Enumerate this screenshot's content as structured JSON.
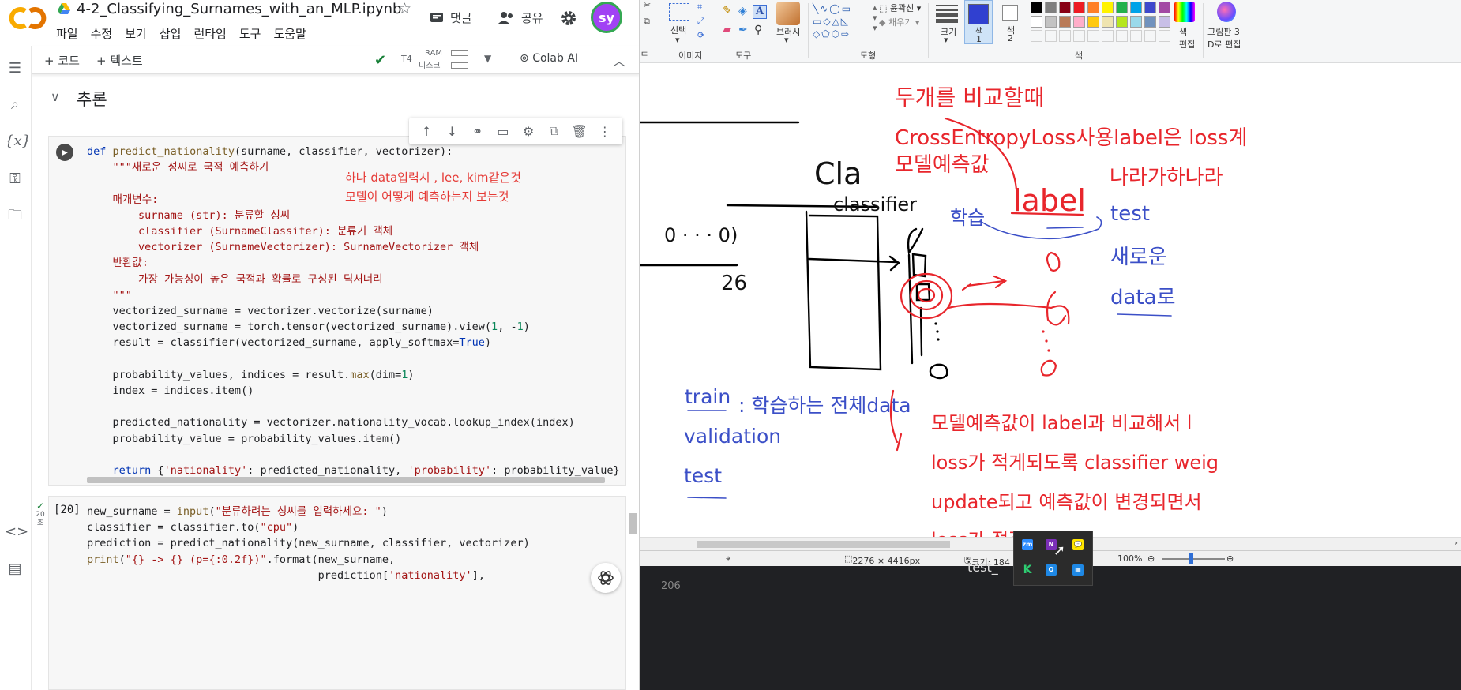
{
  "colab": {
    "title": "4-2_Classifying_Surnames_with_an_MLP.ipynb",
    "header_buttons": {
      "comments": "댓글",
      "share": "공유",
      "avatar": "sy"
    },
    "menu": [
      "파일",
      "수정",
      "보기",
      "삽입",
      "런타임",
      "도구",
      "도움말"
    ],
    "toolbar": {
      "add_code": "+ 코드",
      "add_text": "+ 텍스트",
      "runtime_type": "T4",
      "ram_label": "RAM",
      "disk_label": "디스크",
      "colab_ai": "Colab AI"
    },
    "sidebar_icons": [
      "toc-icon",
      "search-icon",
      "variables-icon",
      "secrets-icon",
      "files-icon",
      "code-snippets-icon",
      "terminal-icon"
    ],
    "section_title": "추론",
    "cell1": {
      "annotation_line1": "하나 data입력시 , lee, kim같은것",
      "annotation_line2": "모델이 어떻게 예측하는지 보는것"
    },
    "cell2": {
      "exec_count": "[20]",
      "status_time": "20",
      "status_unit": "초"
    },
    "colors": {
      "accent_orange": "#f9ab00",
      "avatar_bg": "#a142f4",
      "run_ok": "#188038"
    }
  },
  "paint": {
    "ribbon": {
      "groups": [
        "이미지",
        "도구",
        "도형",
        "색"
      ],
      "select_label": "선택",
      "brush_label": "브러시",
      "outline_label": "윤곽선",
      "fill_label": "채우기",
      "size_label": "크기",
      "color1_label": "색 1",
      "color2_label": "색 2",
      "edit_colors": "색 편집",
      "paint3d_line1": "그림판 3",
      "paint3d_line2": "D로 편집"
    },
    "status": {
      "dimensions": "2276 × 4416px",
      "size": "크기: 184",
      "zoom": "100%"
    },
    "handwriting": {
      "red_compare": "두개를 비교할때",
      "red_ce": "CrossEntropyLoss사용label은 loss계",
      "red_model_pred": "모델예측값",
      "red_country": "나라가하나라",
      "black_cla": "Cla",
      "black_classifier": "classifier",
      "black_0dots": "0 · · · 0)",
      "black_26": "26",
      "blue_learn": "학습",
      "red_label": "label",
      "blue_test": "test",
      "blue_new": "새로운",
      "blue_data": "data로",
      "blue_train": "train",
      "blue_train_desc": ": 학습하는 전체data",
      "blue_validation": "validation",
      "blue_test2": "test",
      "red_bottom1": "모델예측값이 label과 비교해서 l",
      "red_bottom2": "loss가 적게되도록 classifier weig",
      "red_bottom3": "update되고 예측값이 변경되면서",
      "red_bottom4": "loss가 점점 작아짐"
    },
    "taskbar_text": "test_",
    "taskbar_num": "206"
  }
}
